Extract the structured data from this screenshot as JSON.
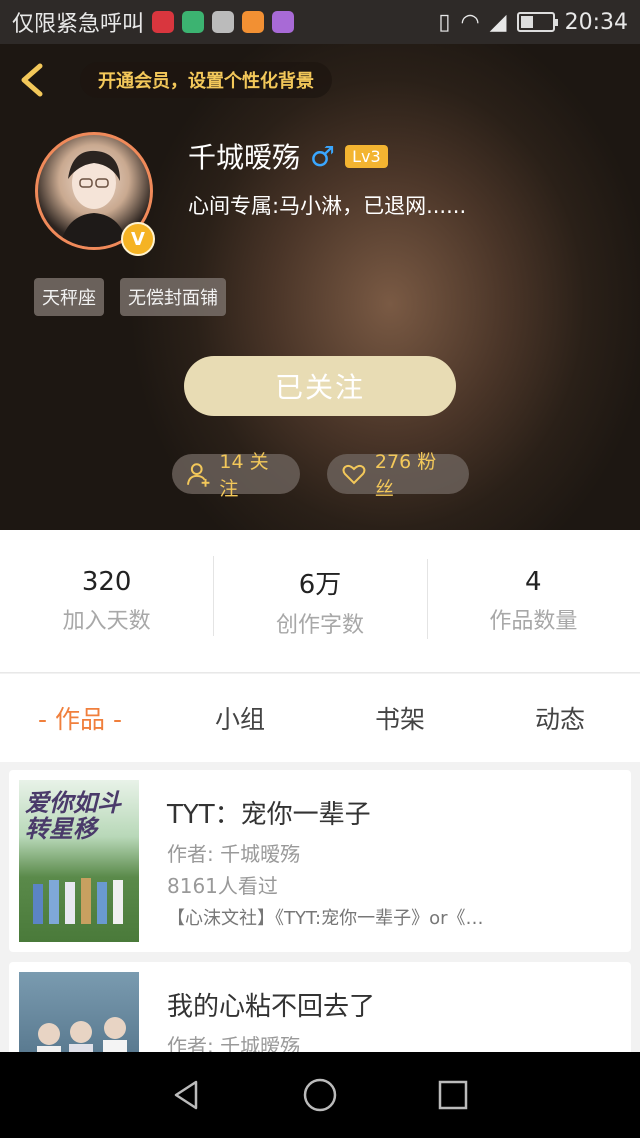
{
  "status_bar": {
    "carrier": "仅限紧急呼叫",
    "time": "20:34"
  },
  "header": {
    "vip_banner": "开通会员，设置个性化背景",
    "username": "千城暧殇",
    "gender_symbol": "♂",
    "level": "Lv3",
    "verified_badge": "V",
    "bio": "心间专属:马小淋，已退网......",
    "tags": [
      "天秤座",
      "无偿封面铺"
    ],
    "follow_button": "已关注",
    "following": "14 关注",
    "fans": "276 粉丝"
  },
  "stats": [
    {
      "value": "320",
      "label": "加入天数"
    },
    {
      "value": "6万",
      "label": "创作字数"
    },
    {
      "value": "4",
      "label": "作品数量"
    }
  ],
  "tabs": [
    {
      "label": "- 作品 -",
      "active": true
    },
    {
      "label": "小组",
      "active": false
    },
    {
      "label": "书架",
      "active": false
    },
    {
      "label": "动态",
      "active": false
    }
  ],
  "works": [
    {
      "cover_title": "爱你如斗转星移",
      "title": "TYT：宠你一辈子",
      "author": "作者: 千城暧殇",
      "views": "8161人看过",
      "description": "【心沫文社】《TYT:宠你一辈子》or《…"
    },
    {
      "title": "我的心粘不回去了",
      "author": "作者: 千城暧殇"
    }
  ],
  "colors": {
    "accent": "#f07f3c",
    "gold": "#f3c85a",
    "follow_button_bg": "#e8dcb4"
  }
}
